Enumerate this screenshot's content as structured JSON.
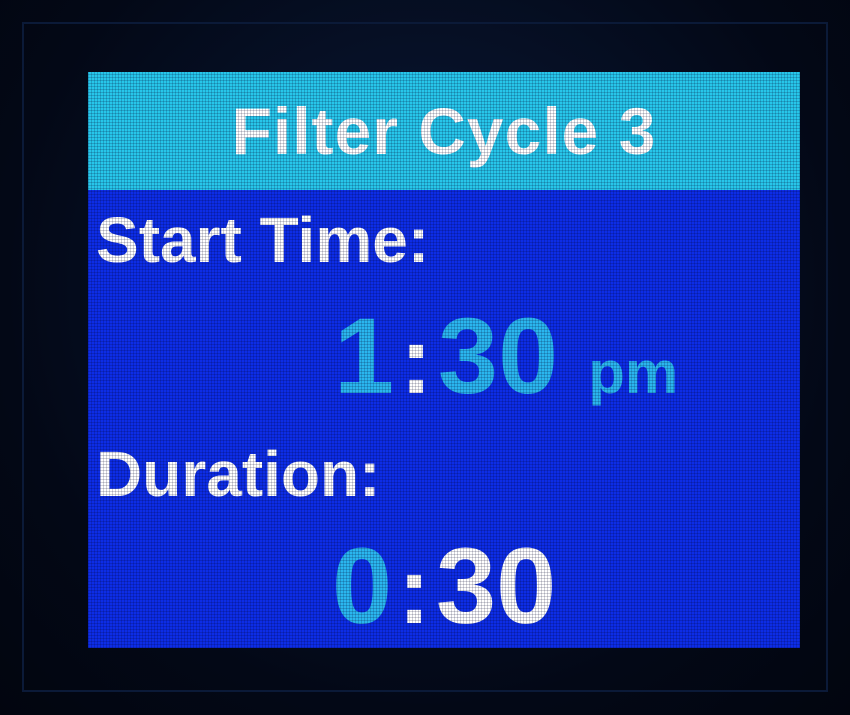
{
  "screen": {
    "title": "Filter Cycle 3",
    "start_time": {
      "label": "Start Time:",
      "hours": "1",
      "separator": ":",
      "minutes": "30",
      "meridiem": "pm"
    },
    "duration": {
      "label": "Duration:",
      "hours": "0",
      "separator": ":",
      "minutes": "30"
    }
  },
  "colors": {
    "screen_background": "#0d2de6",
    "title_bar": "#27c6ea",
    "highlight_value": "#2ab6ef",
    "text": "#ffffff",
    "bezel": "#050c1e"
  }
}
